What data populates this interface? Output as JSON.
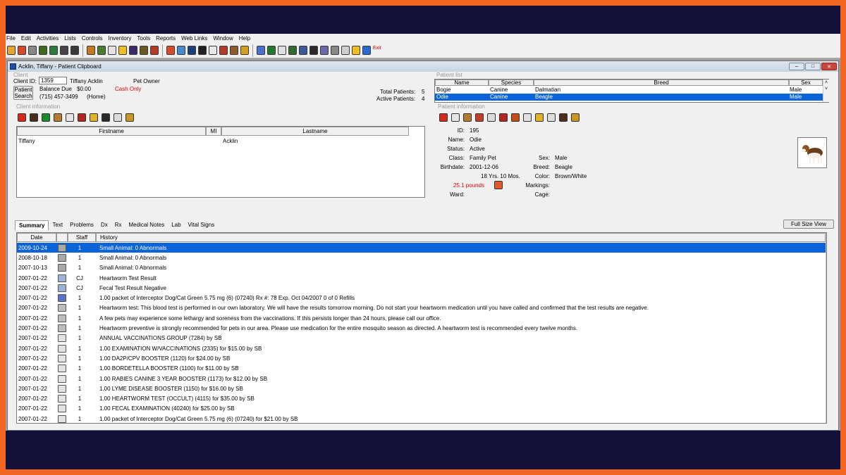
{
  "menu": [
    "File",
    "Edit",
    "Activities",
    "Lists",
    "Controls",
    "Inventory",
    "Tools",
    "Reports",
    "Web Links",
    "Window",
    "Help"
  ],
  "toolbar": {
    "icons": [
      "new-icon",
      "add-icon",
      "scissors-icon",
      "tag-icon",
      "money-icon",
      "medicine-icon",
      "find-icon",
      "folder-icon",
      "link-icon",
      "document-icon",
      "chart-icon",
      "bag-icon",
      "flask-icon",
      "edit-icon",
      "check-icon",
      "image-icon",
      "book-icon",
      "glasses-icon",
      "calculator-icon",
      "calendar-icon",
      "home-icon",
      "trophy-icon",
      "notes-icon",
      "report-icon",
      "layout-icon",
      "spreadsheet-icon",
      "printer-icon",
      "camera-icon",
      "stack-icon",
      "search-icon",
      "list-icon",
      "help-icon",
      "globe-icon"
    ],
    "exit_label": "Exit"
  },
  "window": {
    "title": "Acklin, Tiffany - Patient Clipboard"
  },
  "client": {
    "section_label": "Client",
    "client_id_label": "Client ID:",
    "client_id": "1359",
    "name": "Tiffany Acklin",
    "role": "Pet Owner",
    "balance_label": "Balance Due",
    "balance": "$0.00",
    "payment": "Cash Only",
    "phone": "(715) 457-3499",
    "phone_type": "(Home)",
    "patient_search_label_1": "Patient",
    "patient_search_label_2": "Search",
    "total_patients_label": "Total Patients:",
    "total_patients": "5",
    "active_patients_label": "Active Patients:",
    "active_patients": "4"
  },
  "client_information": {
    "section_label": "Client information",
    "headers": [
      "Firstname",
      "MI",
      "Lastname"
    ],
    "row": {
      "firstname": "Tiffany",
      "mi": "",
      "lastname": "Acklin"
    }
  },
  "patient_list": {
    "section_label": "Patient list",
    "headers": [
      "Name",
      "Species",
      "Breed",
      "Sex"
    ],
    "rows": [
      {
        "name": "Bogie",
        "species": "Canine",
        "breed": "Dalmatian",
        "sex": "Male"
      },
      {
        "name": "Odie",
        "species": "Canine",
        "breed": "Beagle",
        "sex": "Male"
      }
    ]
  },
  "patient_information": {
    "section_label": "Patient information",
    "id_label": "ID:",
    "id": "195",
    "name_label": "Name:",
    "name": "Odie",
    "status_label": "Status:",
    "status": "Active",
    "class_label": "Class:",
    "class": "Family Pet",
    "birthdate_label": "Birthdate:",
    "birthdate": "2001-12-06",
    "age": "18 Yrs. 10 Mos.",
    "weight": "25.1 pounds",
    "ward_label": "Ward:",
    "ward": "",
    "sex_label": "Sex:",
    "sex": "Male",
    "breed_label": "Breed:",
    "breed": "Beagle",
    "color_label": "Color:",
    "color": "Brown/White",
    "markings_label": "Markings:",
    "markings": "",
    "cage_label": "Cage:",
    "cage": ""
  },
  "tabs": [
    "Summary",
    "Text",
    "Problems",
    "Dx",
    "Rx",
    "Medical Notes",
    "Lab",
    "Vital Signs"
  ],
  "full_size_view_label": "Full Size View",
  "history": {
    "headers": [
      "Date",
      "",
      "Staff",
      "History"
    ],
    "rows": [
      {
        "date": "2009-10-24",
        "staff": "1",
        "history": "Small Animal: 0 Abnormals",
        "selected": true
      },
      {
        "date": "2008-10-18",
        "staff": "1",
        "history": "Small Animal: 0 Abnormals"
      },
      {
        "date": "2007-10-13",
        "staff": "1",
        "history": "Small Animal: 0 Abnormals"
      },
      {
        "date": "2007-01-22",
        "staff": "CJ",
        "history": "Heartworm Test Result"
      },
      {
        "date": "2007-01-22",
        "staff": "CJ",
        "history": "Fecal Test Result Negative"
      },
      {
        "date": "2007-01-22",
        "staff": "1",
        "history": "1.00 packet of Interceptor Dog/Cat Green 5.75 mg (6) (07240) Rx #: 78  Exp. Oct 04/2007 0 of 0 Refills"
      },
      {
        "date": "2007-01-22",
        "staff": "1",
        "history": "Heartworm test:  This blood test is performed in our own laboratory.  We will have the results tomorrow morning.  Do not start your heartworm medication until you have called and confirmed that the test results are negative."
      },
      {
        "date": "2007-01-22",
        "staff": "1",
        "history": "A few pets may experience some lethargy and soreness from the vaccinations.  If this persists longer than 24 hours, please call our office."
      },
      {
        "date": "2007-01-22",
        "staff": "1",
        "history": "Heartworm preventive is strongly recommended for pets in our area.  Please use medication for the entire mosquito season as directed.  A heartworm test is recommended every twelve months."
      },
      {
        "date": "2007-01-22",
        "staff": "1",
        "history": "ANNUAL VACCINATIONS GROUP (7284) by SB"
      },
      {
        "date": "2007-01-22",
        "staff": "1",
        "history": "1.00 EXAMINATION W/VACCINATIONS (2335) for $15.00 by SB"
      },
      {
        "date": "2007-01-22",
        "staff": "1",
        "history": "1.00 DA2P/CPV BOOSTER (1120) for $24.00 by SB"
      },
      {
        "date": "2007-01-22",
        "staff": "1",
        "history": "1.00 BORDETELLA BOOSTER (1100) for $11.00 by SB"
      },
      {
        "date": "2007-01-22",
        "staff": "1",
        "history": "1.00 RABIES CANINE 3 YEAR BOOSTER (1173) for $12.00 by SB"
      },
      {
        "date": "2007-01-22",
        "staff": "1",
        "history": "1.00 LYME DISEASE BOOSTER (1150) for $16.00 by SB"
      },
      {
        "date": "2007-01-22",
        "staff": "1",
        "history": "1.00 HEARTWORM TEST (OCCULT) (4115) for $35.00 by SB"
      },
      {
        "date": "2007-01-22",
        "staff": "1",
        "history": "1.00 FECAL EXAMINATION (40240) for $25.00 by SB"
      },
      {
        "date": "2007-01-22",
        "staff": "1",
        "history": "1.00 packet of Interceptor Dog/Cat Green 5.75 mg (6) (07240) for $21.00 by SB"
      }
    ]
  }
}
